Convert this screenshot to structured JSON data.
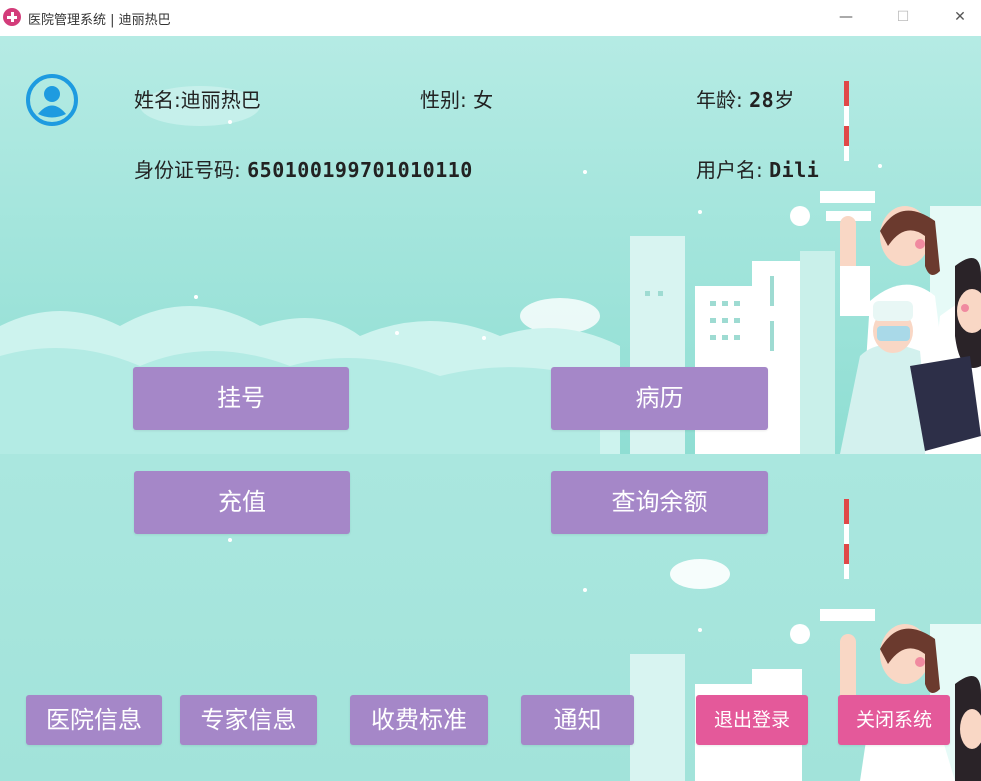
{
  "window": {
    "title": "医院管理系统 | 迪丽热巴",
    "minimize_glyph": "—",
    "maximize_glyph": "☐",
    "close_glyph": "✕"
  },
  "profile": {
    "name_label": "姓名:",
    "name_value": "迪丽热巴",
    "gender_label": "性别:",
    "gender_value": "女",
    "age_label": "年龄:",
    "age_value": "28",
    "age_unit": "岁",
    "id_label": "身份证号码:",
    "id_value": "650100199701010110",
    "username_label": "用户名:",
    "username_value": "Dili"
  },
  "main_buttons": {
    "register": "挂号",
    "medical_record": "病历",
    "recharge": "充值",
    "query_balance": "查询余额"
  },
  "bottom_buttons": {
    "hospital_info": "医院信息",
    "expert_info": "专家信息",
    "fee_standard": "收费标准",
    "notice": "通知",
    "logout": "退出登录",
    "close_system": "关闭系统"
  },
  "colors": {
    "background": "#a8e6de",
    "button_purple": "#a587c8",
    "button_pink": "#e4599a",
    "avatar_blue": "#1e9be0"
  }
}
